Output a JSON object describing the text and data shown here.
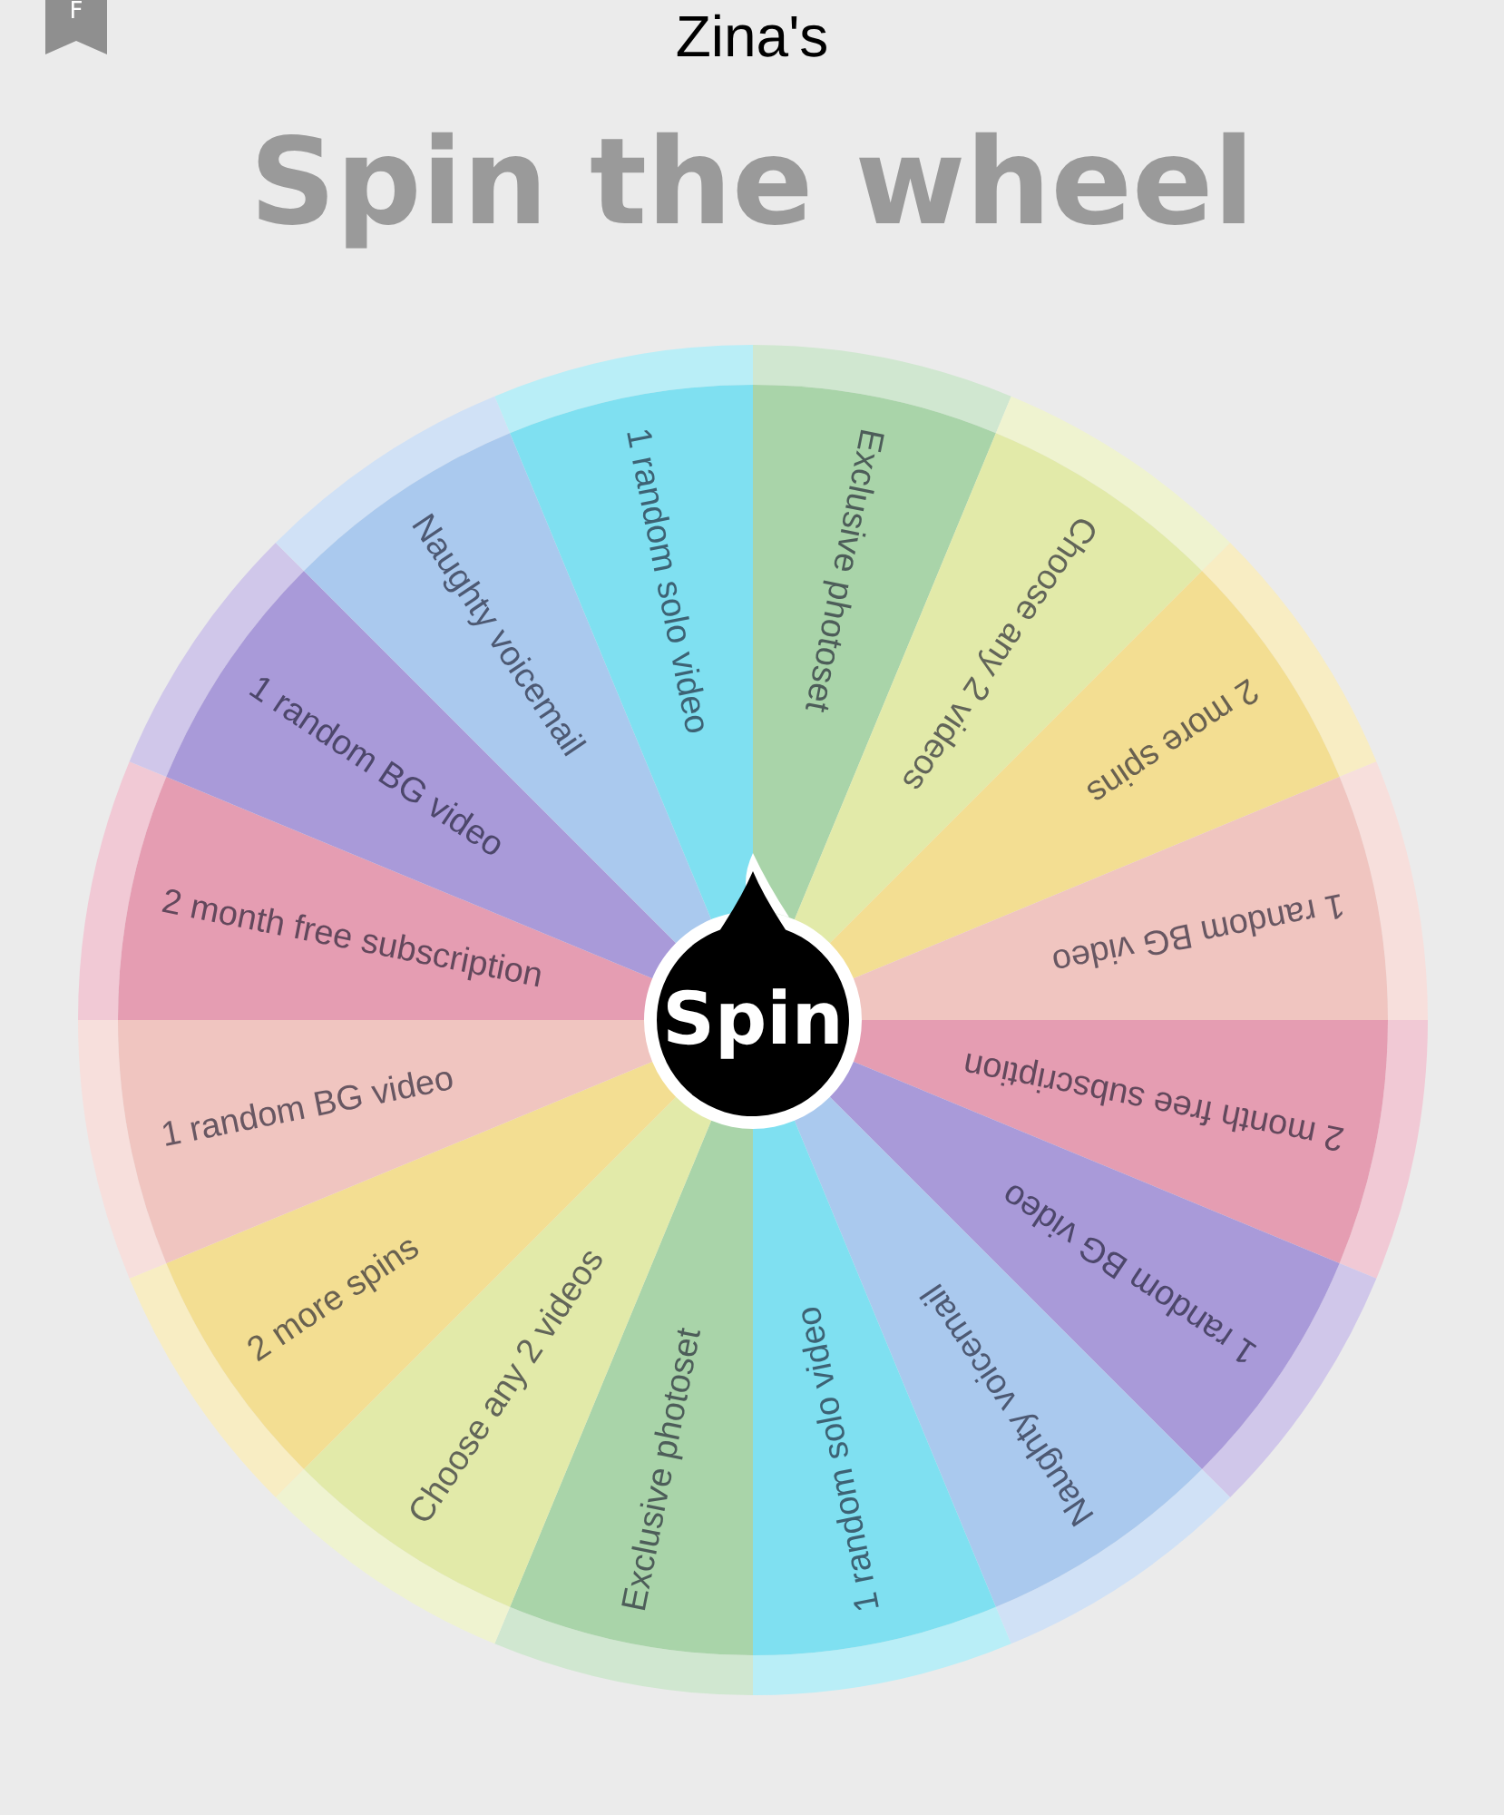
{
  "header": {
    "bookmark_badge": "F",
    "title": "Zina's"
  },
  "heading": "Spin the wheel",
  "wheel": {
    "segments": [
      {
        "label": "Exclusive photoset",
        "color": "#a9d4a9"
      },
      {
        "label": "Choose any 2 videos",
        "color": "#e2eaa9"
      },
      {
        "label": "2 more spins",
        "color": "#f3de92"
      },
      {
        "label": "1 random BG video",
        "color": "#f0c5c0"
      },
      {
        "label": "2 month free subscription",
        "color": "#e59db2"
      },
      {
        "label": "1 random BG video",
        "color": "#a99ad9"
      },
      {
        "label": "Naughty voicemail",
        "color": "#aac9ee"
      },
      {
        "label": "1 random solo video",
        "color": "#7fe0f1"
      },
      {
        "label": "Exclusive photoset",
        "color": "#a9d4a9"
      },
      {
        "label": "Choose any 2 videos",
        "color": "#e2eaa9"
      },
      {
        "label": "2 more spins",
        "color": "#f3de92"
      },
      {
        "label": "1 random BG video",
        "color": "#f0c5c0"
      },
      {
        "label": "2 month free subscription",
        "color": "#e59db2"
      },
      {
        "label": "1 random BG video",
        "color": "#a99ad9"
      },
      {
        "label": "Naughty voicemail",
        "color": "#aac9ee"
      },
      {
        "label": "1 random solo video",
        "color": "#7fe0f1"
      }
    ],
    "spin_button": "Spin"
  }
}
